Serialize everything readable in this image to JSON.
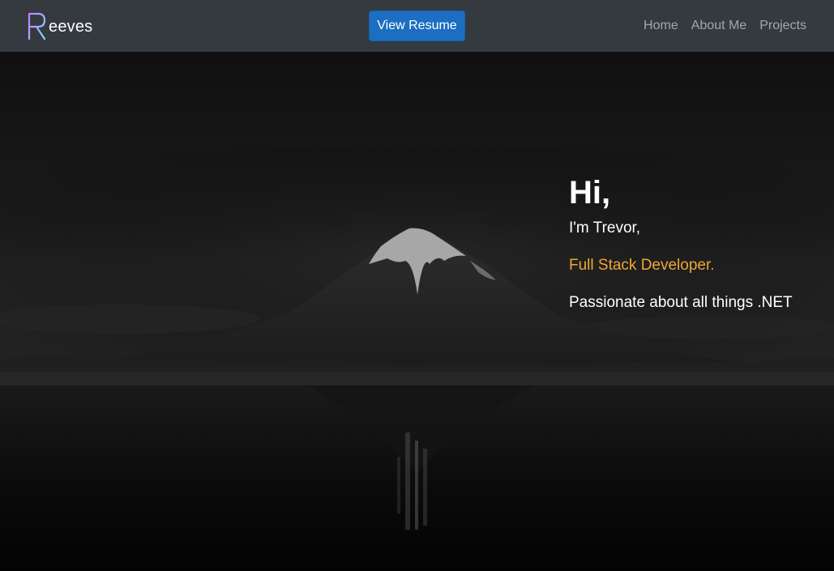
{
  "navbar": {
    "brand_text": "eeves",
    "brand_logo_letter": "R",
    "brand_logo_gradient": [
      "#c77dff",
      "#7fd8ff"
    ],
    "resume_button": "View Resume",
    "links": [
      {
        "label": "Home"
      },
      {
        "label": "About Me"
      },
      {
        "label": "Projects"
      }
    ]
  },
  "hero": {
    "greeting": "Hi,",
    "name_line": "I'm Trevor,",
    "role": "Full Stack Developer.",
    "tagline": "Passionate about all things .NET",
    "accent_color": "#f0a830"
  },
  "colors": {
    "navbar_bg": "#343a40",
    "button_bg": "#1b6ec2",
    "page_bg": "#0b0b0b"
  }
}
